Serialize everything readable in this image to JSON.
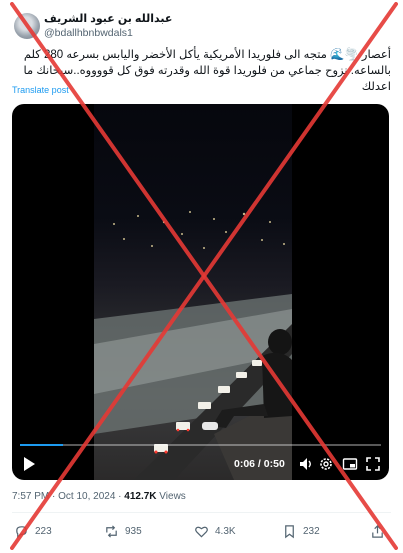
{
  "tweet": {
    "display_name": "عبدالله بن عبود الشريف",
    "handle": "@bdallhbnbwdals1",
    "text": "أعصار 🌪️🌊 متجه الى فلوريدا الأمريكية يأكل الأخضر واليابس بسرعه 280 كلم بالساعه. نزوح جماعي من فلوريدا قوة الله وقدرته فوق كل قووووه..سبحانك ما اعدلك",
    "translate_label": "Translate post"
  },
  "video": {
    "time_label": "0:06 / 0:50",
    "progress": 0.12
  },
  "meta": {
    "timestamp": "7:57 PM · Oct 10, 2024 · ",
    "views_count": "412.7K",
    "views_label": " Views"
  },
  "actions": {
    "replies": "223",
    "reposts": "935",
    "likes": "4.3K",
    "bookmarks": "232"
  },
  "colors": {
    "accent": "#1d9bf0",
    "watermark_x": "#e53935"
  }
}
